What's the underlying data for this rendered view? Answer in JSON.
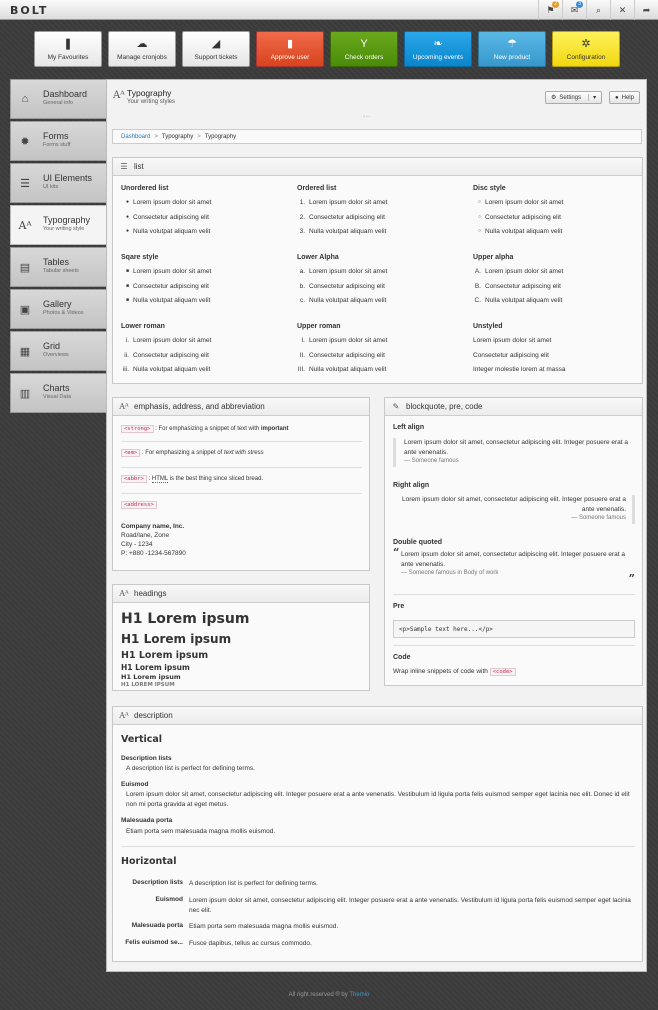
{
  "app": {
    "logo": "BOLT"
  },
  "topbar": {
    "icons": [
      {
        "name": "flag-icon",
        "glyph": "⚑",
        "badge": "2",
        "badge_color": "orange"
      },
      {
        "name": "mail-icon",
        "glyph": "✉",
        "badge": "3",
        "badge_color": "blue"
      },
      {
        "name": "search-icon",
        "glyph": "⌕",
        "badge": null
      },
      {
        "name": "tools-icon",
        "glyph": "✕",
        "badge": null
      },
      {
        "name": "logout-icon",
        "glyph": "➦",
        "badge": null
      }
    ]
  },
  "shortcuts": [
    {
      "label": "My Favourites",
      "icon": "bookmark-icon",
      "glyph": "❚",
      "color": "white"
    },
    {
      "label": "Manage cronjobs",
      "icon": "cloud-icon",
      "glyph": "☁",
      "color": "white"
    },
    {
      "label": "Support tickets",
      "icon": "megaphone-icon",
      "glyph": "◢",
      "color": "white"
    },
    {
      "label": "Approve user",
      "icon": "bar-chart-icon",
      "glyph": "▮",
      "color": "red"
    },
    {
      "label": "Check orders",
      "icon": "cocktail-icon",
      "glyph": "Y",
      "color": "green"
    },
    {
      "label": "Upcoming events",
      "icon": "leaf-icon",
      "glyph": "❧",
      "color": "blue"
    },
    {
      "label": "New product",
      "icon": "umbrella-icon",
      "glyph": "☂",
      "color": "lblue"
    },
    {
      "label": "Configuration",
      "icon": "gears-icon",
      "glyph": "✲",
      "color": "yellow"
    }
  ],
  "sidebar": {
    "items": [
      {
        "title": "Dashboard",
        "sub": "General info",
        "icon": "home-icon",
        "glyph": "⌂"
      },
      {
        "title": "Forms",
        "sub": "Forms stuff",
        "icon": "gear-icon",
        "glyph": "✹"
      },
      {
        "title": "UI Elements",
        "sub": "UI kits",
        "icon": "sliders-icon",
        "glyph": "☰"
      },
      {
        "title": "Typography",
        "sub": "Your writing style",
        "icon": "typography-icon",
        "glyph": "Aᴬ",
        "active": true
      },
      {
        "title": "Tables",
        "sub": "Tabular sheets",
        "icon": "table-icon",
        "glyph": "▤"
      },
      {
        "title": "Gallery",
        "sub": "Photos & Videos",
        "icon": "image-icon",
        "glyph": "▣"
      },
      {
        "title": "Grid",
        "sub": "Overviews",
        "icon": "grid-icon",
        "glyph": "▦"
      },
      {
        "title": "Charts",
        "sub": "Visual Data",
        "icon": "chart-icon",
        "glyph": "▥"
      }
    ]
  },
  "page": {
    "title": "Typography",
    "subtitle": "Your writing styles",
    "settings_label": "Settings",
    "help_label": "Help"
  },
  "breadcrumb": [
    "Dashboard",
    "Typography",
    "Typography"
  ],
  "list_panel": {
    "title": "list",
    "columns": [
      {
        "heading": "Unordered list",
        "markers": [
          "●",
          "●",
          "●"
        ],
        "items": [
          "Lorem ipsum dolor sit amet",
          "Consectetur adipiscing elit",
          "Nulla volutpat aliquam velit"
        ]
      },
      {
        "heading": "Ordered list",
        "markers": [
          "1.",
          "2.",
          "3."
        ],
        "items": [
          "Lorem ipsum dolor sit amet",
          "Consectetur adipiscing elit",
          "Nulla volutpat aliquam velit"
        ]
      },
      {
        "heading": "Disc style",
        "markers": [
          "○",
          "○",
          "○"
        ],
        "items": [
          "Lorem ipsum dolor sit amet",
          "Consectetur adipiscing elit",
          "Nulla volutpat aliquam velit"
        ]
      },
      {
        "heading": "Sqare style",
        "markers": [
          "■",
          "■",
          "■"
        ],
        "items": [
          "Lorem ipsum dolor sit amet",
          "Consectetur adipiscing elit",
          "Nulla volutpat aliquam velit"
        ]
      },
      {
        "heading": "Lower Alpha",
        "markers": [
          "a.",
          "b.",
          "c."
        ],
        "items": [
          "Lorem ipsum dolor sit amet",
          "Consectetur adipiscing elit",
          "Nulla volutpat aliquam velit"
        ]
      },
      {
        "heading": "Upper alpha",
        "markers": [
          "A.",
          "B.",
          "C."
        ],
        "items": [
          "Lorem ipsum dolor sit amet",
          "Consectetur adipiscing elit",
          "Nulla volutpat aliquam velit"
        ]
      },
      {
        "heading": "Lower roman",
        "markers": [
          "i.",
          "ii.",
          "iii."
        ],
        "items": [
          "Lorem ipsum dolor sit amet",
          "Consectetur adipiscing elit",
          "Nulla volutpat aliquam velit"
        ]
      },
      {
        "heading": "Upper roman",
        "markers": [
          "I.",
          "II.",
          "III."
        ],
        "items": [
          "Lorem ipsum dolor sit amet",
          "Consectetur adipiscing elit",
          "Nulla volutpat aliquam velit"
        ]
      },
      {
        "heading": "Unstyled",
        "markers": [
          "",
          "",
          ""
        ],
        "items": [
          "Lorem ipsum dolor sit amet",
          "Consectetur adipiscing elit",
          "Integer molestie lorem at massa"
        ]
      }
    ]
  },
  "emphasis_panel": {
    "title": "emphasis, address, and abbreviation",
    "strong_tag": "<strong>",
    "strong_text": ": For emphasizing a snippet of text with ",
    "strong_word": "important",
    "em_tag": "<em>",
    "em_text": ": For emphasizing a snippet of ",
    "em_word": "text with stress",
    "abbr_tag": "<abbr>",
    "abbr_word": "HTML",
    "abbr_text": " is the best thing since sliced bread.",
    "address_tag": "<address>",
    "address_lines": [
      "Company name, Inc.",
      "Road/lane, Zone",
      "City - 1234",
      "P: +880 -1234-567890"
    ]
  },
  "headings_panel": {
    "title": "headings",
    "items": [
      "H1 Lorem ipsum",
      "H1 Lorem ipsum",
      "H1 Lorem ipsum",
      "H1 Lorem ipsum",
      "H1 Lorem ipsum",
      "H1 LOREM IPSUM"
    ]
  },
  "blockquote_panel": {
    "title": "blockquote, pre, code",
    "left_label": "Left align",
    "left_text": "Lorem ipsum dolor sit amet, consectetur adipiscing elit. Integer posuere erat a ante venenatis.",
    "left_footer": "— Someone famous",
    "right_label": "Right align",
    "right_text": "Lorem ipsum dolor sit amet, consectetur adipiscing elit. Integer posuere erat a ante venenatis.",
    "right_footer": "— Someone famous",
    "double_label": "Double quoted",
    "double_text": "Lorem ipsum dolor sit amet, consectetur adipiscing elit. Integer posuere erat a ante venenatis.",
    "double_footer": "— Someone famous in Body of work",
    "open_quote": "“",
    "close_quote": "”",
    "pre_label": "Pre",
    "pre_text": "<p>Sample text here...</p>",
    "code_label": "Code",
    "code_text": "Wrap inline snippets of code with ",
    "code_tag": "<code>"
  },
  "description_panel": {
    "title": "description",
    "vertical_heading": "Vertical",
    "vertical": [
      {
        "term": "Description lists",
        "desc": "A description list is perfect for defining terms."
      },
      {
        "term": "Euismod",
        "desc": "Lorem ipsum dolor sit amet, consectetur adipiscing elit. Integer posuere erat a ante venenatis. Vestibulum id ligula porta felis euismod semper eget lacinia nec elit. Donec id elit non mi porta gravida at eget metus."
      },
      {
        "term": "Malesuada porta",
        "desc": "Etiam porta sem malesuada magna mollis euismod."
      }
    ],
    "horizontal_heading": "Horizontal",
    "horizontal": [
      {
        "term": "Description lists",
        "desc": "A description list is perfect for defining terms."
      },
      {
        "term": "Euismod",
        "desc": "Lorem ipsum dolor sit amet, consectetur adipiscing elit. Integer posuere erat a ante venenatis. Vestibulum id ligula porta felis euismod semper eget lacinia nec elit."
      },
      {
        "term": "Malesuada porta",
        "desc": "Etiam porta sem malesuada magna mollis euismod."
      },
      {
        "term": "Felis euismod se...",
        "desc": "Fusce dapibus, tellus ac cursus commodo."
      }
    ]
  },
  "footer": {
    "text": "All right reserved ® by ",
    "link": "Themio"
  }
}
